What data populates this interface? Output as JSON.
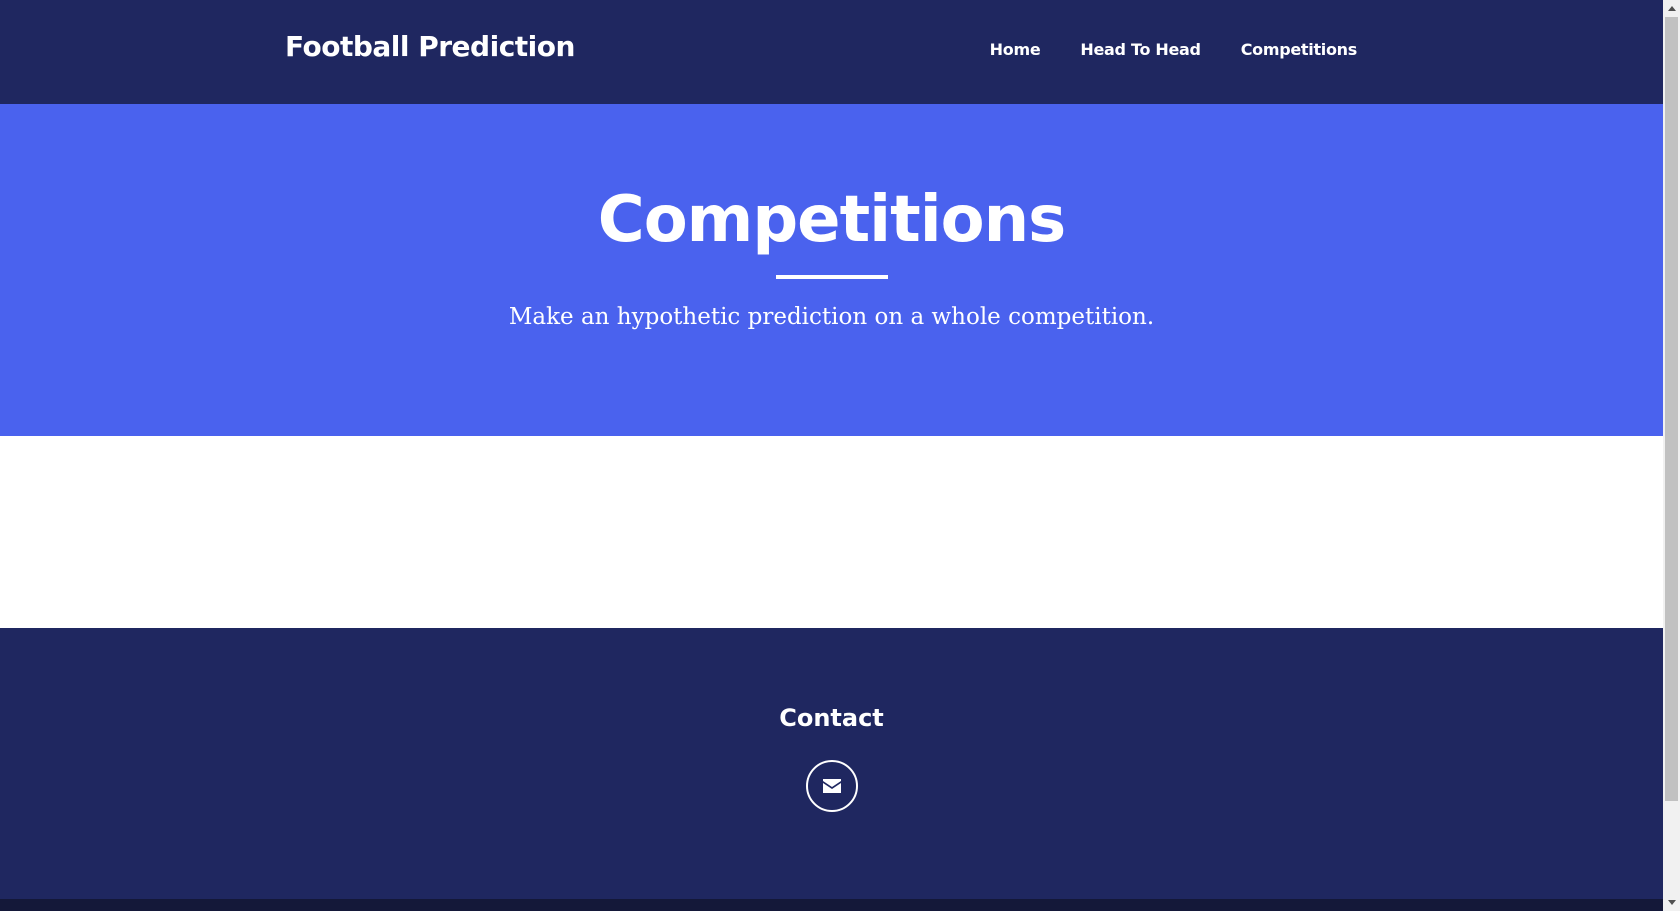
{
  "navbar": {
    "brand": "Football Prediction",
    "links": [
      {
        "label": "Home"
      },
      {
        "label": "Head To Head"
      },
      {
        "label": "Competitions"
      }
    ]
  },
  "hero": {
    "title": "Competitions",
    "subtitle": "Make an hypothetic prediction on a whole competition."
  },
  "footer": {
    "contact_title": "Contact",
    "contact_icon": "envelope-icon"
  },
  "colors": {
    "navbar_bg": "#1f2760",
    "hero_bg": "#4a62ee",
    "text": "#ffffff"
  }
}
